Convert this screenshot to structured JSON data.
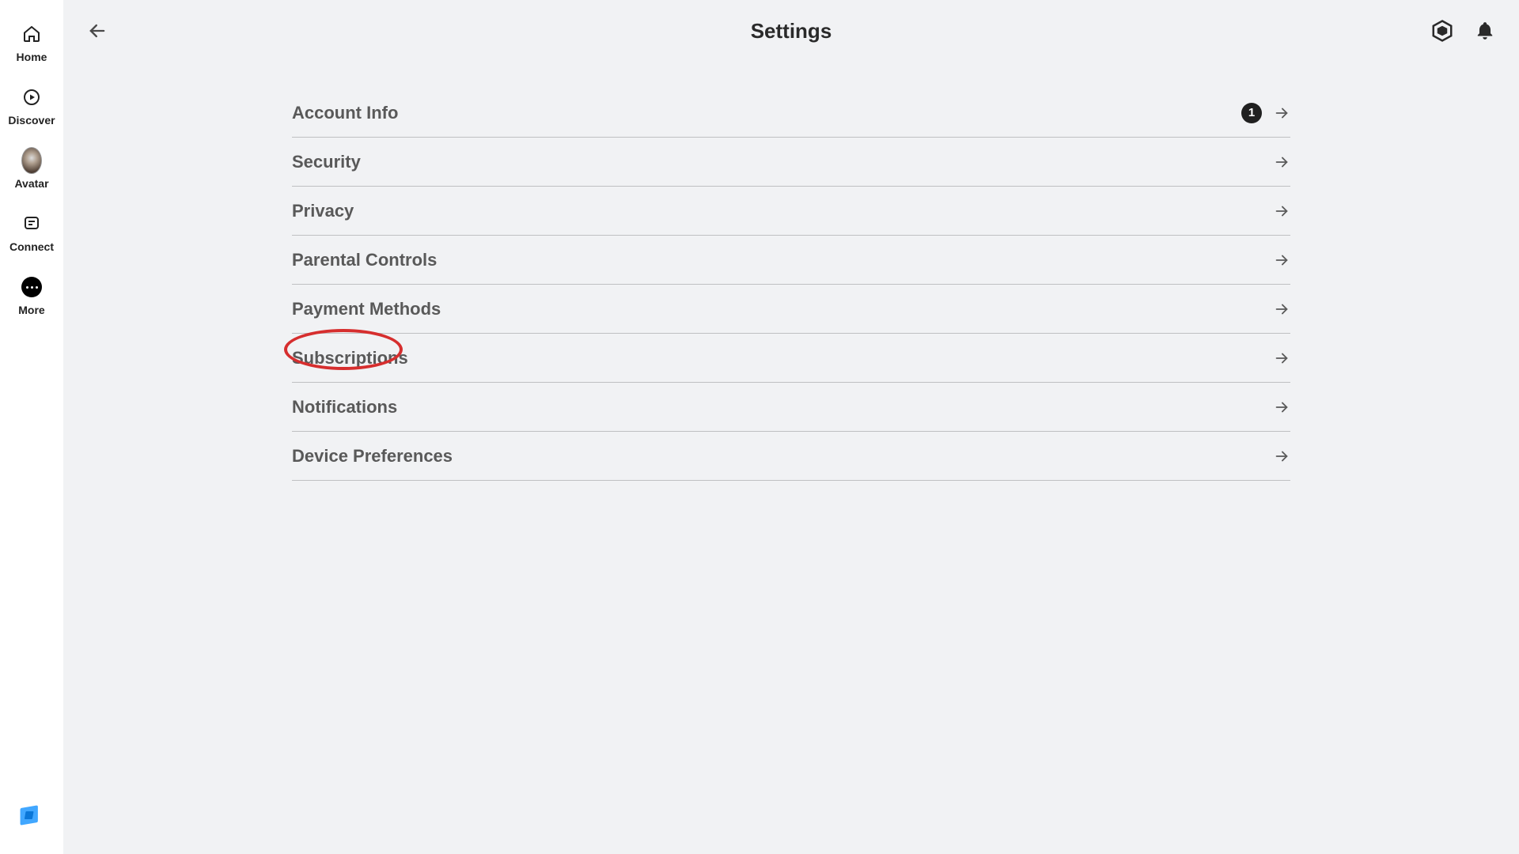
{
  "sidebar": {
    "items": [
      {
        "label": "Home",
        "icon": "home"
      },
      {
        "label": "Discover",
        "icon": "play"
      },
      {
        "label": "Avatar",
        "icon": "avatar"
      },
      {
        "label": "Connect",
        "icon": "chat"
      },
      {
        "label": "More",
        "icon": "more"
      }
    ]
  },
  "header": {
    "title": "Settings"
  },
  "settings": {
    "items": [
      {
        "label": "Account Info",
        "badge": "1"
      },
      {
        "label": "Security"
      },
      {
        "label": "Privacy"
      },
      {
        "label": "Parental Controls"
      },
      {
        "label": "Payment Methods"
      },
      {
        "label": "Subscriptions"
      },
      {
        "label": "Notifications"
      },
      {
        "label": "Device Preferences"
      }
    ]
  },
  "annotation": {
    "target": "Subscriptions"
  }
}
